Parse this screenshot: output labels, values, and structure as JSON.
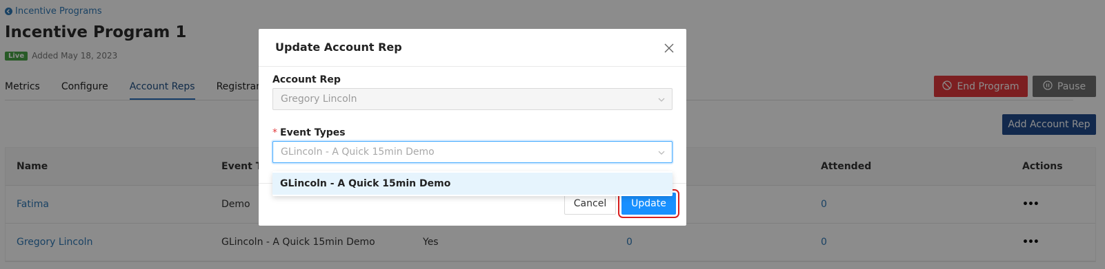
{
  "breadcrumb": {
    "back_label": "Incentive Programs"
  },
  "program": {
    "title": "Incentive Program 1",
    "status_badge": "Live",
    "added_text": "Added May 18, 2023"
  },
  "tabs": [
    {
      "label": "Metrics"
    },
    {
      "label": "Configure"
    },
    {
      "label": "Account Reps"
    },
    {
      "label": "Registrants"
    }
  ],
  "actions": {
    "end_program": "End Program",
    "pause": "Pause",
    "add_account_rep": "Add Account Rep"
  },
  "table": {
    "headers": {
      "name": "Name",
      "event_type": "Event Ty",
      "attended": "Attended",
      "actions": "Actions"
    },
    "rows": [
      {
        "name": "Fatima",
        "event_type": "Demo",
        "opt": "",
        "registered": "",
        "attended": "0",
        "actions": "•••"
      },
      {
        "name": "Gregory Lincoln",
        "event_type": "GLincoln - A Quick 15min Demo",
        "opt": "Yes",
        "registered": "0",
        "attended": "0",
        "actions": "•••"
      }
    ]
  },
  "modal": {
    "title": "Update Account Rep",
    "account_rep_label": "Account Rep",
    "account_rep_value": "Gregory Lincoln",
    "event_types_required_mark": "*",
    "event_types_label": "Event Types",
    "event_types_value": "GLincoln - A Quick 15min Demo",
    "dropdown_options": [
      "GLincoln - A Quick 15min Demo"
    ],
    "cancel_label": "Cancel",
    "update_label": "Update"
  },
  "colors": {
    "primary": "#1890ff",
    "danger": "#e2393c",
    "navy": "#224c8c",
    "live": "#4aa447",
    "highlight_outline": "#d81d1d"
  }
}
